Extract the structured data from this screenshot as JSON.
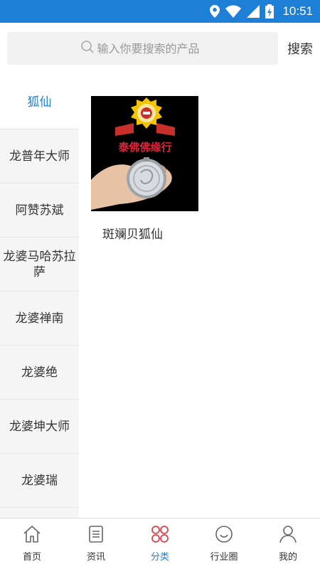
{
  "status": {
    "time": "10:51"
  },
  "search": {
    "placeholder": "输入你要搜索的产品",
    "button_label": "搜索"
  },
  "categories": [
    {
      "label": "狐仙",
      "active": true
    },
    {
      "label": "龙普年大师",
      "active": false
    },
    {
      "label": "阿赞苏斌",
      "active": false
    },
    {
      "label": "龙婆马哈苏拉萨",
      "active": false
    },
    {
      "label": "龙婆禅南",
      "active": false
    },
    {
      "label": "龙婆绝",
      "active": false
    },
    {
      "label": "龙婆坤大师",
      "active": false
    },
    {
      "label": "龙婆瑞",
      "active": false
    }
  ],
  "products": [
    {
      "name": "斑斓贝狐仙",
      "image_banner_text": "泰佛佛缘行"
    }
  ],
  "tabs": [
    {
      "label": "首页",
      "icon": "home-icon",
      "active": false
    },
    {
      "label": "资讯",
      "icon": "news-icon",
      "active": false
    },
    {
      "label": "分类",
      "icon": "category-icon",
      "active": true
    },
    {
      "label": "行业圈",
      "icon": "circle-icon",
      "active": false
    },
    {
      "label": "我的",
      "icon": "profile-icon",
      "active": false
    }
  ],
  "colors": {
    "accent": "#1e7fd6",
    "tab_active_icon": "#e0424a",
    "sidebar_bg": "#f5f5f5"
  }
}
